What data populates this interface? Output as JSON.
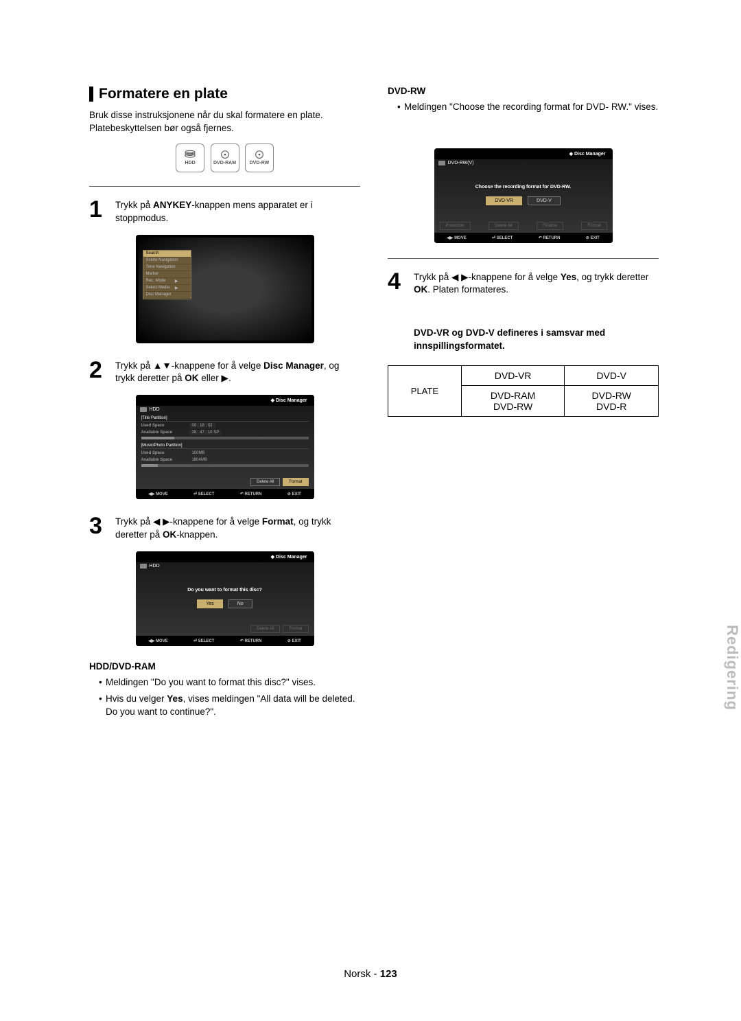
{
  "section_title": "Formatere en plate",
  "intro": "Bruk disse instruksjonene når du skal formatere en plate. Platebeskyttelsen bør også fjernes.",
  "media_icons": [
    "HDD",
    "DVD-RAM",
    "DVD-RW"
  ],
  "step1": {
    "num": "1",
    "pre": "Trykk på ",
    "bold": "ANYKEY",
    "post": "-knappen mens apparatet er i stoppmodus."
  },
  "menu1": {
    "items": [
      "Search",
      "Scene Navigation",
      "Time Navigation",
      "Marker",
      "Rec. Mode",
      "Select Media",
      "Disc Manager"
    ],
    "arrow_items": [
      4,
      5
    ]
  },
  "step2": {
    "num": "2",
    "pre": "Trykk på ▲▼-knappene for å velge ",
    "bold": "Disc Manager",
    "mid": ", og trykk deretter på ",
    "bold2": "OK",
    "post": " eller ▶."
  },
  "dm1": {
    "title": "Disc Manager",
    "hdd": "HDD",
    "title_partition": "[Title Partition]",
    "used_space": "Used Space",
    "used_val": "00 : 18 : 02",
    "avail_space": "Available Space",
    "avail_val": "38 : 47 : 10 SP",
    "mp_partition": "[Music/Photo Partition]",
    "used_mb": "100MB",
    "avail_mb": "1804MB",
    "btn_delete": "Delete All",
    "btn_format": "Format",
    "footer": {
      "move": "MOVE",
      "select": "SELECT",
      "return": "RETURN",
      "exit": "EXIT"
    },
    "footer_icons": {
      "move": "◀▶",
      "select": "⏎",
      "return": "↶",
      "exit": "⊘"
    }
  },
  "step3": {
    "num": "3",
    "pre": "Trykk på ◀ ▶-knappene for å velge ",
    "bold": "Format",
    "mid": ", og trykk deretter på ",
    "bold2": "OK",
    "post": "-knappen."
  },
  "dm2": {
    "title": "Disc Manager",
    "hdd": "HDD",
    "prompt": "Do you want to format this disc?",
    "yes": "Yes",
    "no": "No",
    "btn_delete": "Delete All",
    "btn_format": "Format"
  },
  "hdd_ram": {
    "heading": "HDD/DVD-RAM",
    "b1": "Meldingen \"Do you want to format this disc?\" vises.",
    "b2_pre": "Hvis du velger ",
    "b2_bold": "Yes",
    "b2_post": ", vises meldingen \"All data will be deleted. Do you want to continue?\"."
  },
  "dvd_rw": {
    "heading": "DVD-RW",
    "b1": "Meldingen \"Choose the recording format for DVD- RW.\" vises."
  },
  "dm3": {
    "title": "Disc Manager",
    "hdd": "DVD-RW(V)",
    "prompt": "Choose the recording format for DVD-RW.",
    "opt1": "DVD-VR",
    "opt2": "DVD-V",
    "btn_delete": "Delete All",
    "footer_protection": "Protection",
    "footer_finalize": "Finalise",
    "footer_format": "Format"
  },
  "step4": {
    "num": "4",
    "pre": "Trykk på ◀ ▶-knappene for å velge ",
    "bold": "Yes",
    "mid": ", og trykk deretter ",
    "bold2": "OK",
    "post": ". Platen formateres."
  },
  "note": "DVD-VR og DVD-V defineres i samsvar med innspillingsformatet.",
  "table": {
    "row_head": "PLATE",
    "h1": "DVD-VR",
    "h2": "DVD-V",
    "c1a": "DVD-RAM",
    "c1b": "DVD-RW",
    "c2a": "DVD-RW",
    "c2b": "DVD-R"
  },
  "side_tab": "Redigering",
  "page_label": "Norsk -",
  "page_num": "123"
}
